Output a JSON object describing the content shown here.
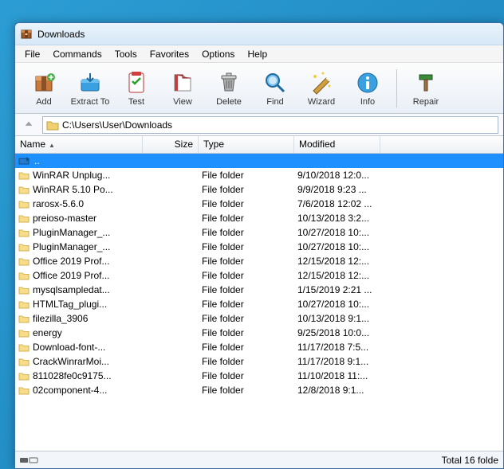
{
  "window": {
    "title": "Downloads"
  },
  "menu": {
    "file": "File",
    "commands": "Commands",
    "tools": "Tools",
    "favorites": "Favorites",
    "options": "Options",
    "help": "Help"
  },
  "toolbar": {
    "add": "Add",
    "extract": "Extract To",
    "test": "Test",
    "view": "View",
    "delete": "Delete",
    "find": "Find",
    "wizard": "Wizard",
    "info": "Info",
    "repair": "Repair"
  },
  "path": "C:\\Users\\User\\Downloads",
  "columns": {
    "name": "Name",
    "size": "Size",
    "type": "Type",
    "modified": "Modified"
  },
  "parent_row": "..",
  "rows": [
    {
      "name": "WinRAR Unplug...",
      "type": "File folder",
      "modified": "9/10/2018 12:0..."
    },
    {
      "name": "WinRAR 5.10 Po...",
      "type": "File folder",
      "modified": "9/9/2018 9:23 ..."
    },
    {
      "name": "rarosx-5.6.0",
      "type": "File folder",
      "modified": "7/6/2018 12:02 ..."
    },
    {
      "name": "preioso-master",
      "type": "File folder",
      "modified": "10/13/2018 3:2..."
    },
    {
      "name": "PluginManager_...",
      "type": "File folder",
      "modified": "10/27/2018 10:..."
    },
    {
      "name": "PluginManager_...",
      "type": "File folder",
      "modified": "10/27/2018 10:..."
    },
    {
      "name": "Office 2019 Prof...",
      "type": "File folder",
      "modified": "12/15/2018 12:..."
    },
    {
      "name": "Office 2019 Prof...",
      "type": "File folder",
      "modified": "12/15/2018 12:..."
    },
    {
      "name": "mysqlsampledat...",
      "type": "File folder",
      "modified": "1/15/2019 2:21 ..."
    },
    {
      "name": "HTMLTag_plugi...",
      "type": "File folder",
      "modified": "10/27/2018 10:..."
    },
    {
      "name": "filezilla_3906",
      "type": "File folder",
      "modified": "10/13/2018 9:1..."
    },
    {
      "name": "energy",
      "type": "File folder",
      "modified": "9/25/2018 10:0..."
    },
    {
      "name": "Download-font-...",
      "type": "File folder",
      "modified": "11/17/2018 7:5..."
    },
    {
      "name": "CrackWinrarMoi...",
      "type": "File folder",
      "modified": "11/17/2018 9:1..."
    },
    {
      "name": "811028fe0c9175...",
      "type": "File folder",
      "modified": "11/10/2018 11:..."
    },
    {
      "name": "02component-4...",
      "type": "File folder",
      "modified": "12/8/2018 9:1..."
    }
  ],
  "status": {
    "total": "Total 16 folde"
  }
}
